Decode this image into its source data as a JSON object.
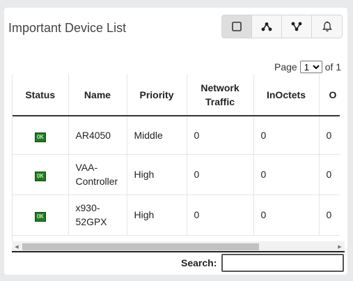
{
  "panel": {
    "title": "Important Device List",
    "view_buttons": [
      {
        "icon": "square-icon"
      },
      {
        "icon": "network-tree-icon"
      },
      {
        "icon": "topology-icon"
      },
      {
        "icon": "bell-icon"
      }
    ]
  },
  "pager": {
    "label": "Page",
    "current": "1",
    "of_label": "of 1"
  },
  "table": {
    "columns": [
      "Status",
      "Name",
      "Priority",
      "Network Traffic",
      "InOctets",
      "O"
    ],
    "rows": [
      {
        "status": "OK",
        "name": "AR4050",
        "priority": "Middle",
        "network_traffic": "0",
        "inoctets": "0",
        "o": "0"
      },
      {
        "status": "OK",
        "name": "VAA-Controller",
        "priority": "High",
        "network_traffic": "0",
        "inoctets": "0",
        "o": "0"
      },
      {
        "status": "OK",
        "name": "x930-52GPX",
        "priority": "High",
        "network_traffic": "0",
        "inoctets": "0",
        "o": "0"
      }
    ]
  },
  "search": {
    "label": "Search:",
    "value": ""
  },
  "colors": {
    "ok_badge": "#1e7b1e",
    "panel_bg": "#ffffff",
    "page_bg": "#e9eaec"
  }
}
